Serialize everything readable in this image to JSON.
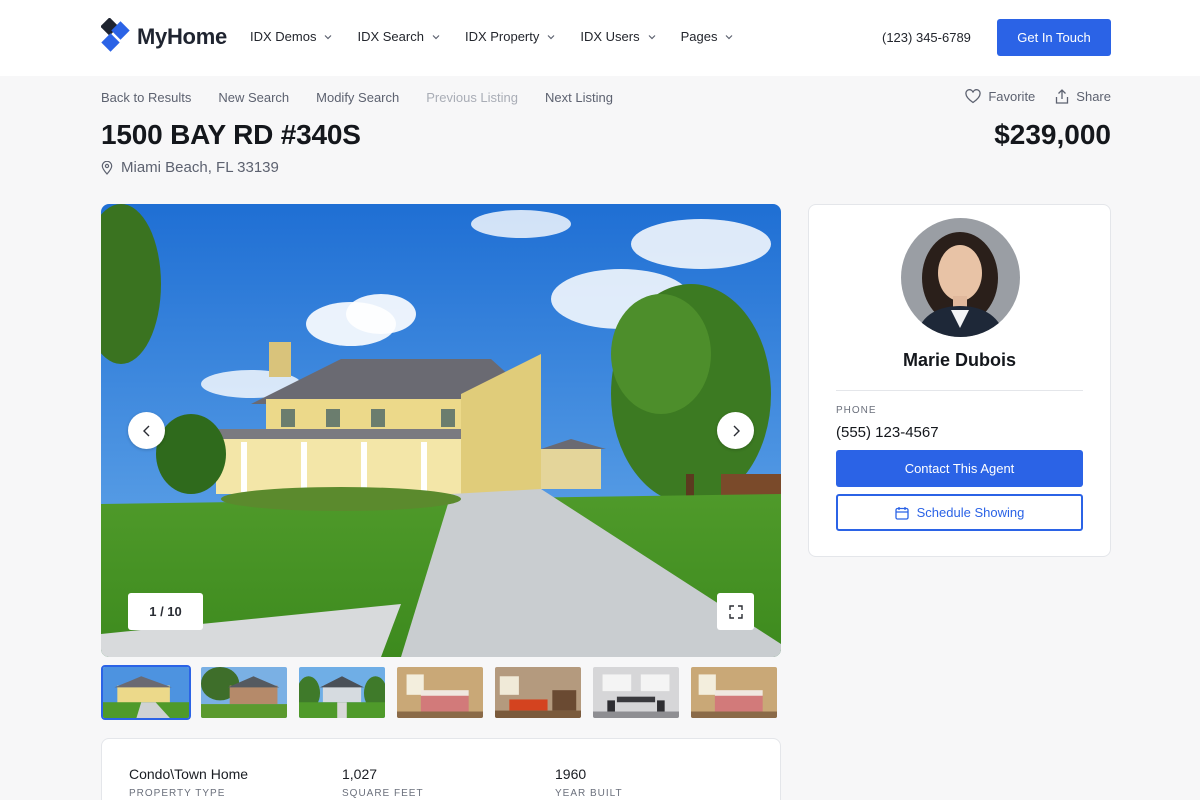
{
  "header": {
    "logo_text": "MyHome",
    "nav": [
      "IDX Demos",
      "IDX Search",
      "IDX Property",
      "IDX Users",
      "Pages"
    ],
    "phone": "(123) 345-6789",
    "cta": "Get In Touch"
  },
  "subnav": {
    "back": "Back to Results",
    "new_search": "New Search",
    "modify": "Modify Search",
    "previous": "Previous Listing",
    "next": "Next Listing"
  },
  "actions": {
    "favorite": "Favorite",
    "share": "Share"
  },
  "listing": {
    "title": "1500 BAY RD #340S",
    "address": "Miami Beach, FL 33139",
    "price": "$239,000"
  },
  "gallery": {
    "counter": "1 / 10",
    "thumbs": [
      "house-front",
      "house-side",
      "house-street",
      "bedroom",
      "living-room",
      "dining-room",
      "bedroom-2"
    ]
  },
  "facts": [
    {
      "value": "Condo\\Town Home",
      "label": "PROPERTY TYPE"
    },
    {
      "value": "1,027",
      "label": "SQUARE FEET"
    },
    {
      "value": "1960",
      "label": "YEAR BUILT"
    }
  ],
  "agent": {
    "name": "Marie Dubois",
    "phone_label": "PHONE",
    "phone": "(555) 123-4567",
    "contact": "Contact This Agent",
    "schedule": "Schedule Showing"
  },
  "colors": {
    "accent": "#2b63e6",
    "text": "#14171c",
    "muted": "#5d6270"
  }
}
